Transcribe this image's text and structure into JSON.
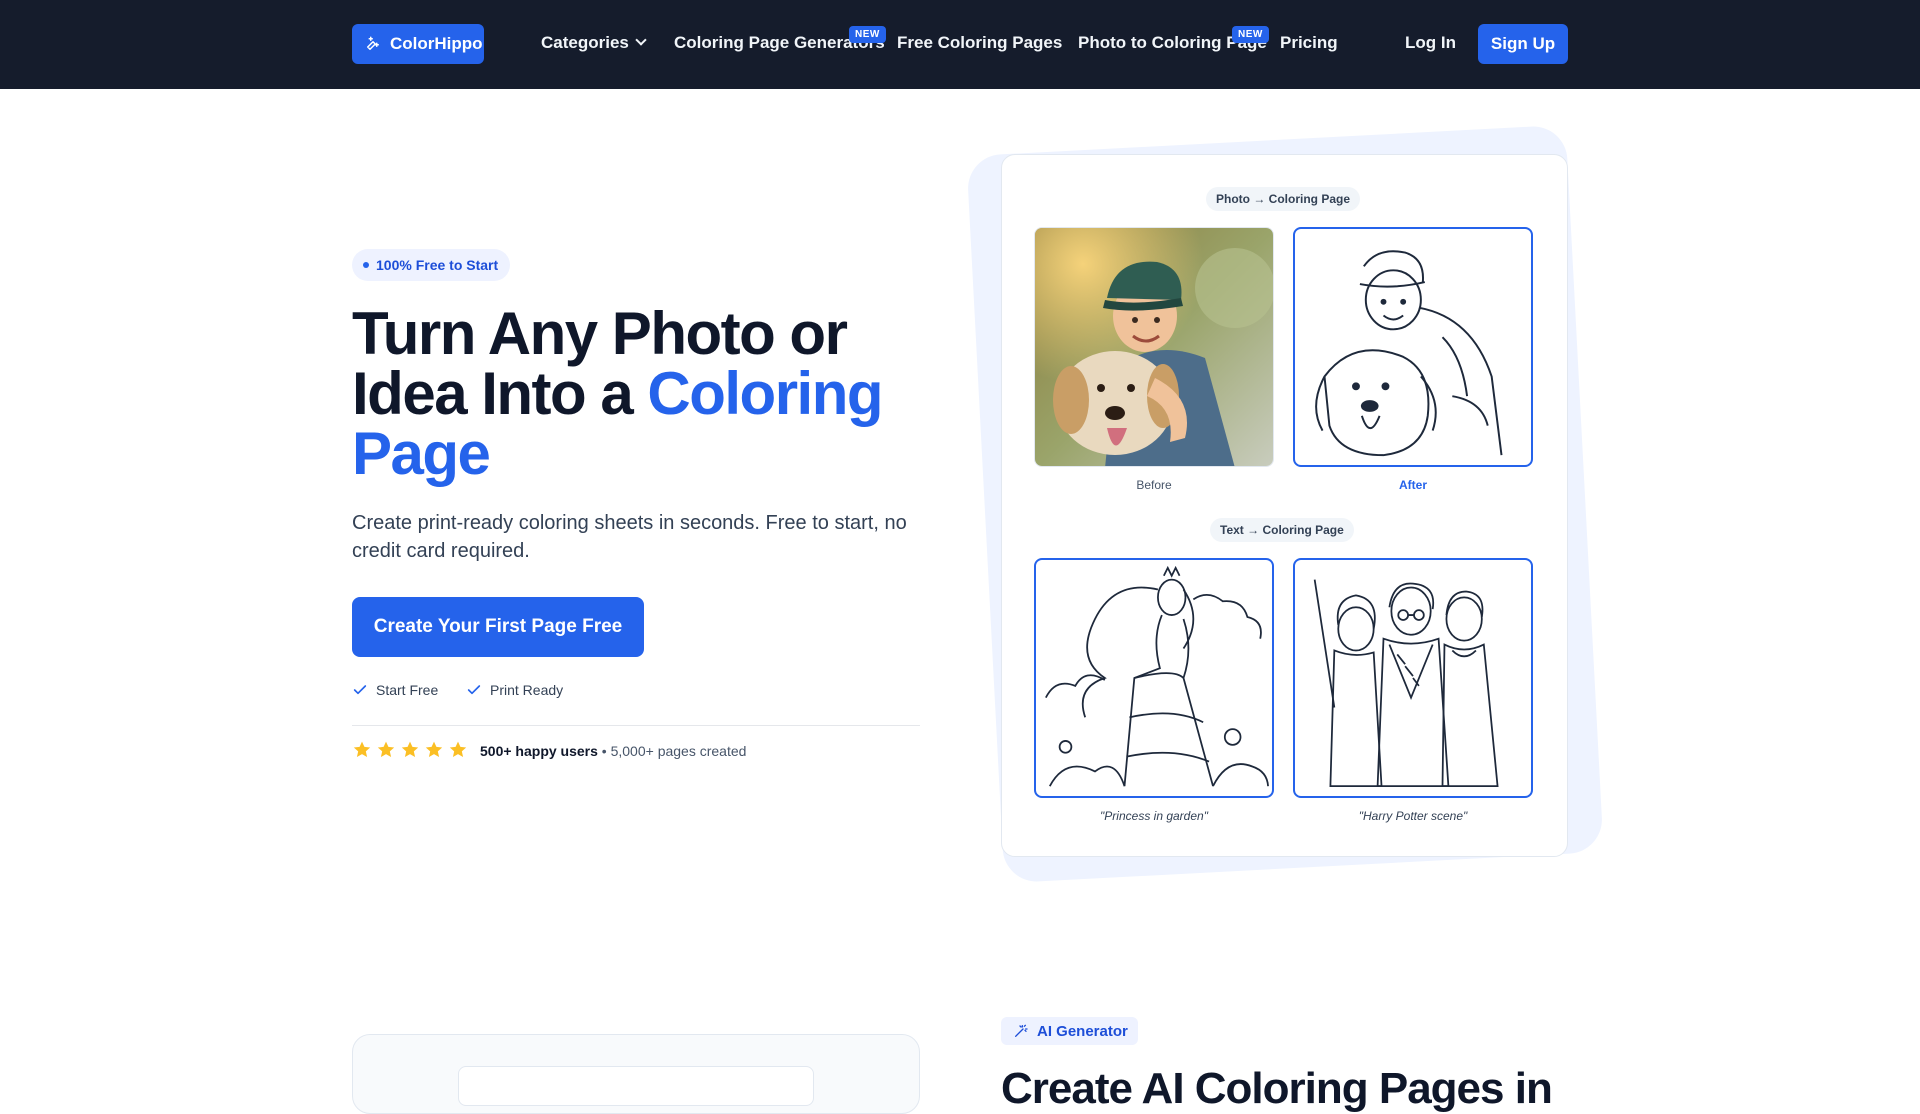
{
  "nav": {
    "logo_label": "ColorHippo",
    "items": [
      {
        "label": "Categories"
      },
      {
        "label": "Coloring Page Generators",
        "badge": "NEW"
      },
      {
        "label": "Free Coloring Pages"
      },
      {
        "label": "Photo to Coloring Page",
        "badge": "NEW"
      },
      {
        "label": "Pricing"
      }
    ],
    "login_label": "Log In",
    "signup_label": "Sign Up"
  },
  "hero": {
    "pill": "100% Free to Start",
    "title_part1": "Turn Any Photo or Idea Into a ",
    "title_accent": "Coloring Page",
    "subtitle": "Create print-ready coloring sheets in seconds. Free to start, no credit card required.",
    "cta_label": "Create Your First Page Free",
    "checks": [
      "Start Free",
      "Print Ready"
    ],
    "stars": 5,
    "users_bold": "500+ happy users",
    "separator": " • ",
    "pages_created": "5,000+ pages created"
  },
  "showcase": {
    "photo_tag": "Photo → Coloring Page",
    "before_caption": "Before",
    "after_caption": "After",
    "text_tag": "Text → Coloring Page",
    "prompt1": "\"Princess in garden\"",
    "prompt2": "\"Harry Potter scene\""
  },
  "section2": {
    "pill": "AI Generator",
    "heading": "Create AI Coloring Pages in"
  },
  "colors": {
    "nav_bg": "#151c2c",
    "accent": "#2563eb",
    "text": "#0f172a",
    "star": "#fbbf24"
  }
}
